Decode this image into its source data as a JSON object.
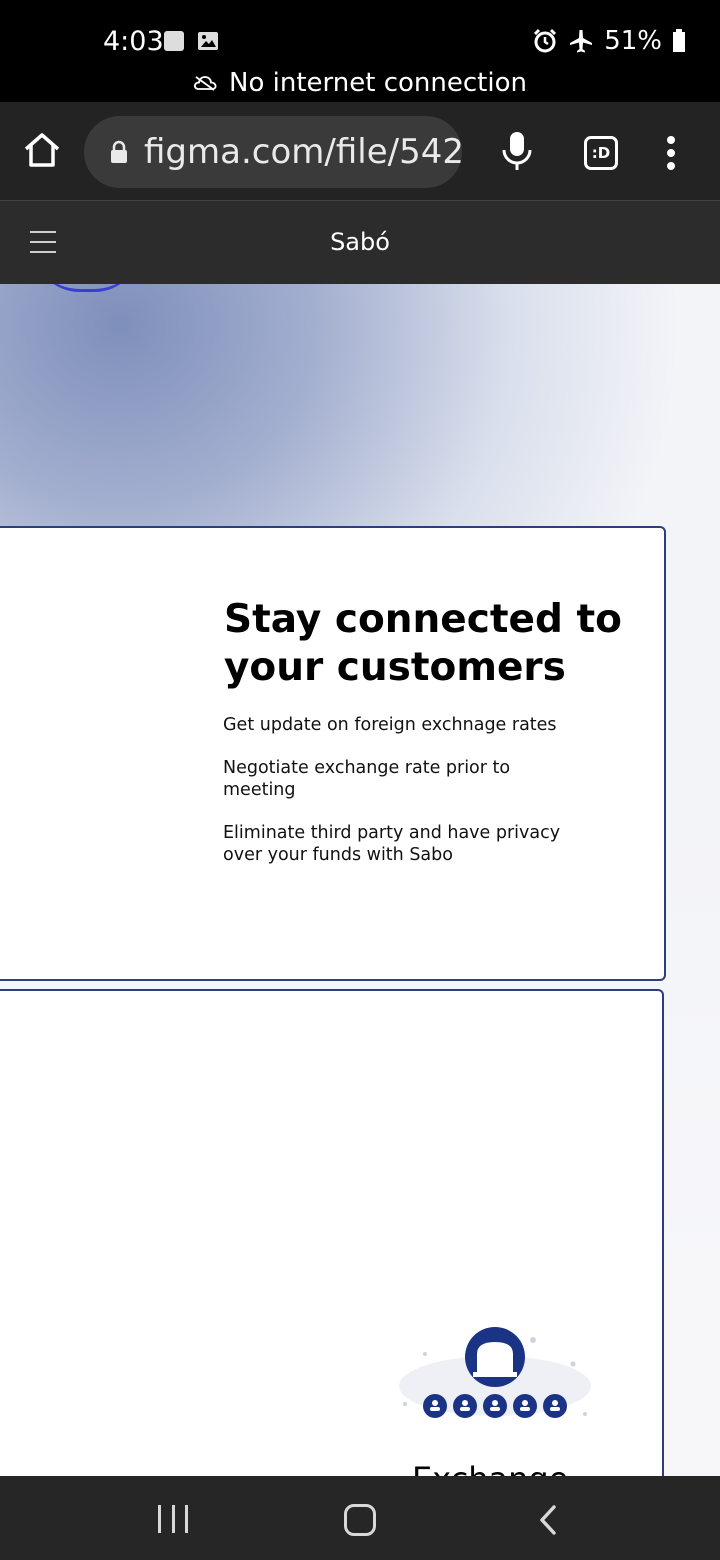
{
  "status_bar": {
    "time": "4:03",
    "battery": "51%",
    "offline_message": "No internet connection"
  },
  "browser": {
    "url": "figma.com/file/542",
    "tab_switcher_label": ":D"
  },
  "app_header": {
    "title": "Sabó"
  },
  "card1": {
    "title": "Stay connected to your customers",
    "features": [
      "Get update on foreign exchnage rates",
      "Negotiate exchange rate prior to meeting",
      "Eliminate third party and have privacy over your funds with Sabo"
    ]
  },
  "card2": {
    "label": "Exchange"
  },
  "colors": {
    "accent": "#1b3384",
    "card_border": "#2c3f7c"
  }
}
